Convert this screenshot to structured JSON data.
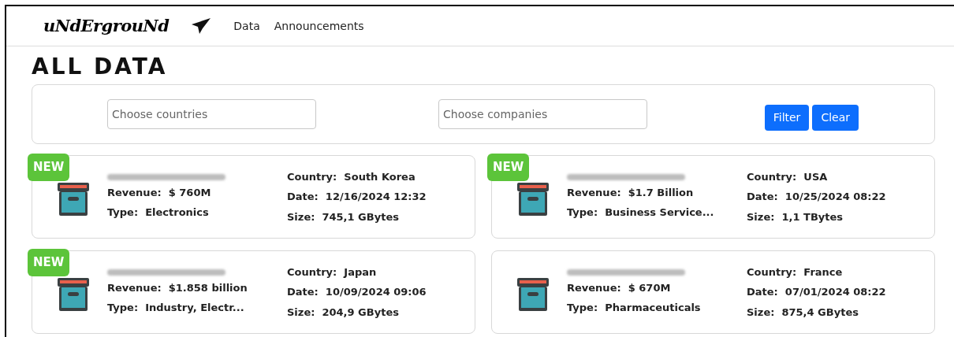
{
  "nav": {
    "logo": "uNdErgrouNd",
    "links": [
      "Data",
      "Announcements"
    ]
  },
  "heading": "ALL DATA",
  "filters": {
    "fields": [
      {
        "placeholder": "Choose countries"
      },
      {
        "placeholder": "Choose companies"
      }
    ],
    "buttons": [
      "Filter",
      "Clear"
    ]
  },
  "cards": [
    {
      "new": true,
      "badge": "NEW",
      "left": [
        {
          "label": "Revenue:",
          "value": "$ 760M"
        },
        {
          "label": "Type:",
          "value": "Electronics"
        }
      ],
      "right": [
        {
          "label": "Country:",
          "value": "South Korea"
        },
        {
          "label": "Date:",
          "value": "12/16/2024 12:32"
        },
        {
          "label": "Size:",
          "value": "745,1 GBytes"
        }
      ]
    },
    {
      "new": true,
      "badge": "NEW",
      "left": [
        {
          "label": "Revenue:",
          "value": "$1.7 Billion"
        },
        {
          "label": "Type:",
          "value": "Business Service..."
        }
      ],
      "right": [
        {
          "label": "Country:",
          "value": "USA"
        },
        {
          "label": "Date:",
          "value": "10/25/2024 08:22"
        },
        {
          "label": "Size:",
          "value": "1,1 TBytes"
        }
      ]
    },
    {
      "new": true,
      "badge": "NEW",
      "left": [
        {
          "label": "Revenue:",
          "value": "$1.858 billion"
        },
        {
          "label": "Type:",
          "value": "Industry, Electr..."
        }
      ],
      "right": [
        {
          "label": "Country:",
          "value": "Japan"
        },
        {
          "label": "Date:",
          "value": "10/09/2024 09:06"
        },
        {
          "label": "Size:",
          "value": "204,9 GBytes"
        }
      ]
    },
    {
      "new": false,
      "left": [
        {
          "label": "Revenue:",
          "value": "$ 670M"
        },
        {
          "label": "Type:",
          "value": "Pharmaceuticals"
        }
      ],
      "right": [
        {
          "label": "Country:",
          "value": "France"
        },
        {
          "label": "Date:",
          "value": "07/01/2024 08:22"
        },
        {
          "label": "Size:",
          "value": "875,4 GBytes"
        }
      ]
    }
  ]
}
